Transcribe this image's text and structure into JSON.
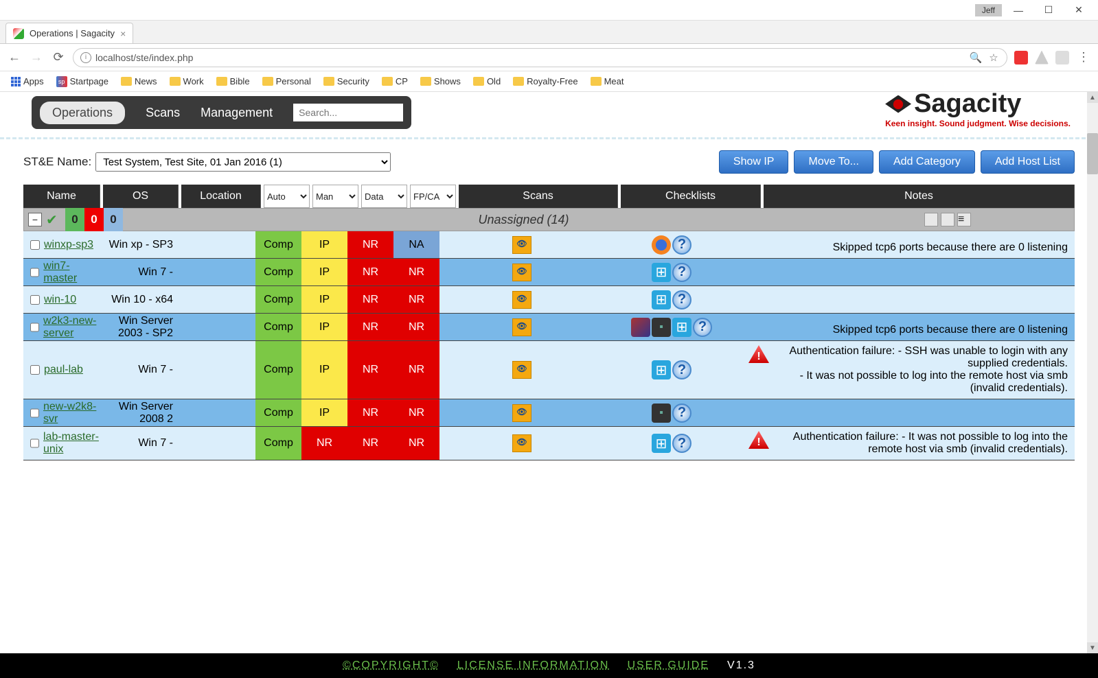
{
  "window": {
    "user": "Jeff"
  },
  "browser": {
    "tab_title": "Operations | Sagacity",
    "url": "localhost/ste/index.php",
    "bookmarks": [
      "Apps",
      "Startpage",
      "News",
      "Work",
      "Bible",
      "Personal",
      "Security",
      "CP",
      "Shows",
      "Old",
      "Royalty-Free",
      "Meat"
    ]
  },
  "nav": {
    "active": "Operations",
    "items": [
      "Operations",
      "Scans",
      "Management"
    ],
    "search_placeholder": "Search..."
  },
  "brand": {
    "name": "Sagacity",
    "tagline": "Keen insight. Sound judgment. Wise decisions."
  },
  "filter": {
    "label": "ST&E Name:",
    "selected": "Test System, Test Site, 01 Jan 2016 (1)"
  },
  "buttons": {
    "showip": "Show IP",
    "moveto": "Move To...",
    "addcat": "Add Category",
    "addhost": "Add Host List"
  },
  "headers": {
    "name": "Name",
    "os": "OS",
    "loc": "Location",
    "auto": "Auto",
    "man": "Man",
    "data": "Data",
    "fp": "FP/CA",
    "scans": "Scans",
    "check": "Checklists",
    "notes": "Notes"
  },
  "group": {
    "title": "Unassigned  (14)",
    "counts": [
      "0",
      "0",
      "0"
    ]
  },
  "rows": [
    {
      "name": "winxp-sp3",
      "os": "Win xp - SP3",
      "auto": "Comp",
      "man": "IP",
      "data": "NR",
      "fp": "NA",
      "fpcls": "blue",
      "check": [
        "ff",
        "q"
      ],
      "note": "Skipped tcp6 ports because there are 0 listening",
      "cls": "light",
      "warn": false
    },
    {
      "name": "win7-master",
      "os": "Win 7 -",
      "auto": "Comp",
      "man": "IP",
      "data": "NR",
      "fp": "NR",
      "fpcls": "red",
      "check": [
        "win",
        "q"
      ],
      "note": "",
      "cls": "mid",
      "warn": false
    },
    {
      "name": "win-10",
      "os": "Win 10 - x64",
      "auto": "Comp",
      "man": "IP",
      "data": "NR",
      "fp": "NR",
      "fpcls": "red",
      "check": [
        "win",
        "q"
      ],
      "note": "",
      "cls": "light",
      "warn": false
    },
    {
      "name": "w2k3-new-server",
      "os": "Win Server 2003 - SP2",
      "auto": "Comp",
      "man": "IP",
      "data": "NR",
      "fp": "NR",
      "fpcls": "red",
      "check": [
        "cube",
        "srv",
        "win",
        "q"
      ],
      "note": "Skipped tcp6 ports because there are 0 listening",
      "cls": "mid",
      "warn": false
    },
    {
      "name": "paul-lab",
      "os": "Win 7 -",
      "auto": "Comp",
      "man": "IP",
      "data": "NR",
      "fp": "NR",
      "fpcls": "red",
      "check": [
        "win",
        "q"
      ],
      "note": "Authentication failure: - SSH was unable to login with any supplied credentials.\n- It was not possible to log into the remote host via smb (invalid credentials).",
      "cls": "light",
      "warn": true
    },
    {
      "name": "new-w2k8-svr",
      "os": "Win Server 2008 2",
      "auto": "Comp",
      "man": "IP",
      "data": "NR",
      "fp": "NR",
      "fpcls": "red",
      "check": [
        "srv",
        "q"
      ],
      "note": "",
      "cls": "mid",
      "warn": false
    },
    {
      "name": "lab-master-unix",
      "os": "Win 7 -",
      "auto": "Comp",
      "man": "NR",
      "data": "NR",
      "fp": "NR",
      "fpcls": "red",
      "mancls": "red",
      "check": [
        "win",
        "q"
      ],
      "note": "Authentication failure: - It was not possible to log into the remote host via smb (invalid credentials).",
      "cls": "light",
      "warn": true
    }
  ],
  "footer": {
    "copy": "©COPYRIGHT©",
    "lic": "LICENSE INFORMATION",
    "guide": "USER GUIDE",
    "ver": "V1.3"
  }
}
